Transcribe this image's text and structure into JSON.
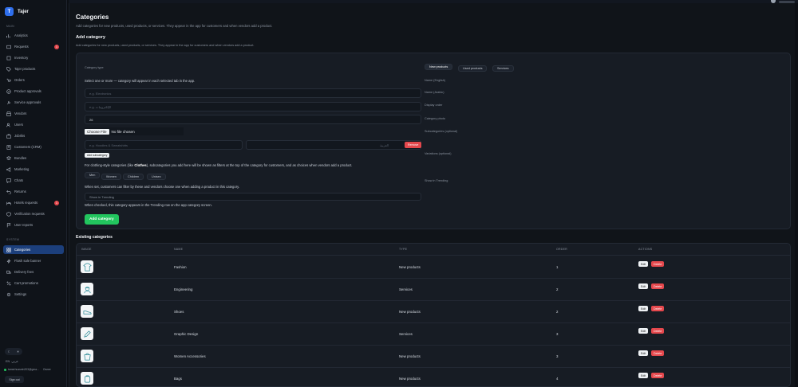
{
  "app": {
    "name": "Tajer",
    "logo_letter": "T"
  },
  "sidebar": {
    "section_main": "MAIN",
    "section_system": "SYSTEM",
    "items": [
      {
        "label": "Analytics",
        "icon": "chart-icon",
        "badge": ""
      },
      {
        "label": "Requests",
        "icon": "inbox-icon",
        "badge": "1"
      },
      {
        "label": "Inventory",
        "icon": "box-icon",
        "badge": ""
      },
      {
        "label": "Tajer products",
        "icon": "tag-icon",
        "badge": ""
      },
      {
        "label": "Orders",
        "icon": "cart-icon",
        "badge": ""
      },
      {
        "label": "Product approvals",
        "icon": "check-icon",
        "badge": ""
      },
      {
        "label": "Service approvals",
        "icon": "wrench-icon",
        "badge": ""
      },
      {
        "label": "Vendors",
        "icon": "store-icon",
        "badge": ""
      },
      {
        "label": "Users",
        "icon": "users-icon",
        "badge": ""
      },
      {
        "label": "Jobriks",
        "icon": "briefcase-icon",
        "badge": ""
      },
      {
        "label": "Customers (CRM)",
        "icon": "contacts-icon",
        "badge": ""
      },
      {
        "label": "Bundles",
        "icon": "layers-icon",
        "badge": ""
      },
      {
        "label": "Marketing",
        "icon": "megaphone-icon",
        "badge": ""
      },
      {
        "label": "Chats",
        "icon": "chat-icon",
        "badge": ""
      },
      {
        "label": "Returns",
        "icon": "return-icon",
        "badge": ""
      },
      {
        "label": "Hotels requests",
        "icon": "bed-icon",
        "badge": "1"
      },
      {
        "label": "Verification requests",
        "icon": "shield-icon",
        "badge": ""
      },
      {
        "label": "User reports",
        "icon": "flag-icon",
        "badge": ""
      }
    ],
    "system_items": [
      {
        "label": "Categories",
        "icon": "grid-icon",
        "active": true
      },
      {
        "label": "Flash sale banner",
        "icon": "bolt-icon",
        "active": false
      },
      {
        "label": "Delivery fees",
        "icon": "truck-icon",
        "active": false
      },
      {
        "label": "Cart promotions",
        "icon": "percent-icon",
        "active": false
      },
      {
        "label": "Settings",
        "icon": "gear-icon",
        "active": false
      }
    ],
    "language": "EN",
    "language_alt": "عربي",
    "user_email": "tamerhussein203@gma...",
    "user_role": "Owner",
    "sign_out": "Sign out"
  },
  "page": {
    "title": "Categories",
    "subtitle": "Add categories for new products, used products, or services. They appear in the app for customers and when vendors add a product."
  },
  "form": {
    "title": "Add category",
    "subtitle": "Add categories for new products, used products, or services. They appear in the app for customers and when vendors add a product.",
    "category_type_label": "Category type",
    "tabs": [
      "New products",
      "Used products",
      "Services"
    ],
    "help_select": "Select one or more — category will appear in each selected tab in the app.",
    "name_en_placeholder": "e.g. Electronics",
    "name_en_label": "Name (English)",
    "name_ar_placeholder": "e.g. الإلكترونيات",
    "name_ar_label": "Name (Arabic)",
    "display_order_value": "26",
    "display_order_label": "Display order",
    "photo_label": "Category photo",
    "file_button": "Choose File",
    "file_status": "No file chosen",
    "sub_label": "Subcategories (optional)",
    "sub_en_placeholder": "e.g. Hoodies & Sweatshirts",
    "sub_ar_placeholder": "العربية",
    "remove_label": "Remove",
    "add_sub_label": "Add subcategory",
    "variations_label": "Variations (optional)",
    "clothing_help_prefix": "For clothing-style categories (like ",
    "clothing_help_bold": "Clothes",
    "clothing_help_suffix": "), subcategories you add here will be shown as filters at the top of the category for customers, and as choices when vendors add a product.",
    "gender_chips": [
      "Men",
      "Women",
      "Children",
      "Unisex"
    ],
    "filter_help": "When set, customers can filter by these and vendors choose one when adding a product in this category.",
    "trending_label": "Show in Trending",
    "trending_field": "Show in Trending",
    "trending_help": "When checked, this category appears in the Trending row on the app category screen.",
    "submit_label": "Add category"
  },
  "table": {
    "title": "Existing categories",
    "headers": [
      "IMAGE",
      "NAME",
      "TYPE",
      "ORDER",
      "ACTIONS"
    ],
    "edit_label": "Edit",
    "delete_label": "Delete",
    "rows": [
      {
        "name": "Fashion",
        "type": "New products",
        "order": "1",
        "icon": "tshirt-icon"
      },
      {
        "name": "Engineering",
        "type": "Services",
        "order": "2",
        "icon": "engineer-icon"
      },
      {
        "name": "Shoes",
        "type": "New products",
        "order": "2",
        "icon": "shoe-icon"
      },
      {
        "name": "Graphic Design",
        "type": "Services",
        "order": "3",
        "icon": "pen-icon"
      },
      {
        "name": "Women Accessories",
        "type": "New products",
        "order": "3",
        "icon": "bag-icon"
      },
      {
        "name": "Bags",
        "type": "New products",
        "order": "4",
        "icon": "backpack-icon"
      }
    ]
  },
  "colors": {
    "accent": "#2f6fed",
    "active_nav": "#1c3f7c",
    "danger": "#e5484d",
    "success": "#22c55e",
    "background": "#101419"
  }
}
